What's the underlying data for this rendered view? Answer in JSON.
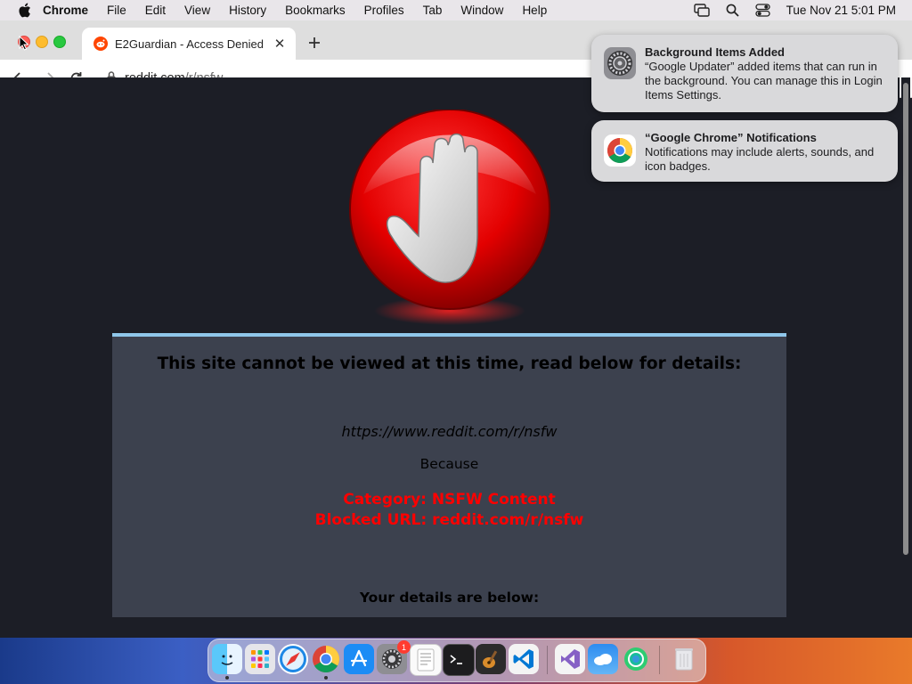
{
  "menubar": {
    "app_name": "Chrome",
    "menus": [
      "File",
      "Edit",
      "View",
      "History",
      "Bookmarks",
      "Profiles",
      "Tab",
      "Window",
      "Help"
    ],
    "clock": "Tue Nov 21  5:01 PM"
  },
  "browser": {
    "tab_title": "E2Guardian - Access Denied",
    "url_host": "reddit.com",
    "url_path": "/r/nsfw"
  },
  "page": {
    "headline": "This site cannot be viewed at this time, read below for details:",
    "blocked_url": "https://www.reddit.com/r/nsfw",
    "because": "Because",
    "category": "Category: NSFW Content",
    "blocked_reason": "Blocked URL: reddit.com/r/nsfw",
    "details": "Your details are below:"
  },
  "notifications": [
    {
      "title": "Background Items Added",
      "body": "“Google Updater” added items that can run in the background. You can manage this in Login Items Settings."
    },
    {
      "title": "“Google Chrome” Notifications",
      "body": "Notifications may include alerts, sounds, and icon badges."
    }
  ],
  "dock": {
    "items": [
      "finder-icon",
      "launchpad-icon",
      "safari-icon",
      "chrome-icon",
      "app-store-icon",
      "system-settings-icon",
      "textedit-icon",
      "terminal-icon",
      "garageband-icon",
      "vscode-icon",
      "visual-studio-icon",
      "weather-icon",
      "browser-icon",
      "trash-icon"
    ],
    "settings_badge": "1"
  },
  "colors": {
    "reason_red": "#ff0000",
    "panel_bg": "#3c414e",
    "panel_top_border": "#8fc7ea",
    "page_bg": "#1c1e26"
  }
}
